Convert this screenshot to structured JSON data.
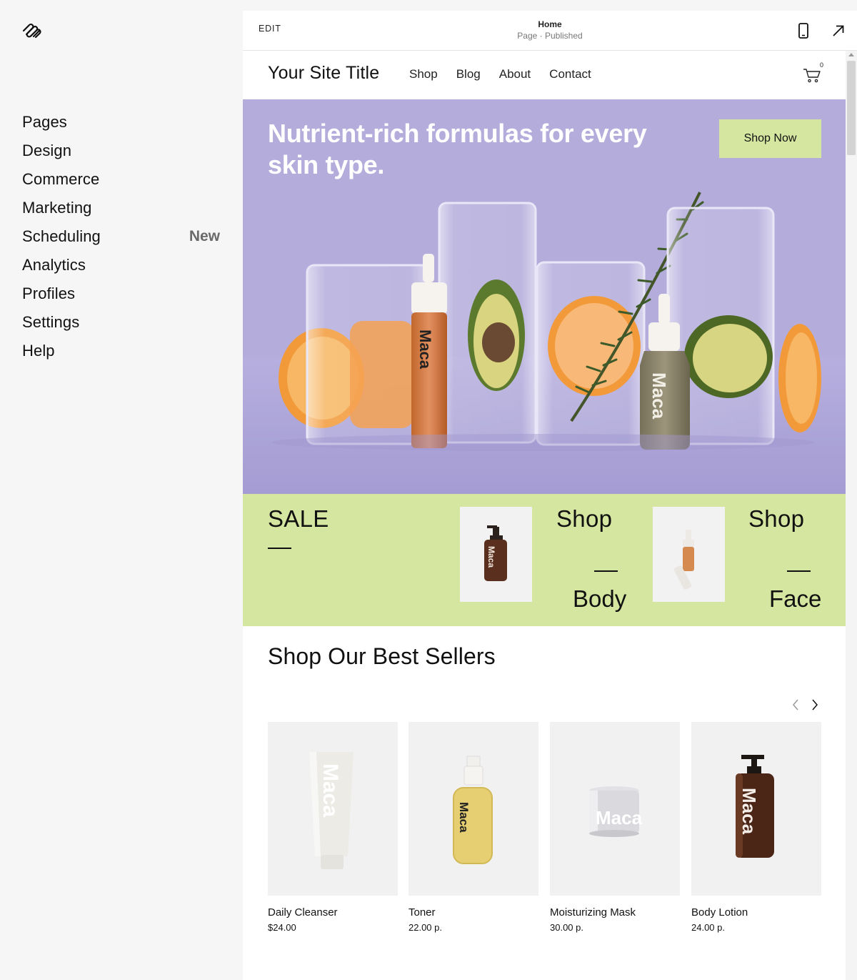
{
  "sidebar": {
    "items": [
      {
        "label": "Pages",
        "badge": ""
      },
      {
        "label": "Design",
        "badge": ""
      },
      {
        "label": "Commerce",
        "badge": ""
      },
      {
        "label": "Marketing",
        "badge": ""
      },
      {
        "label": "Scheduling",
        "badge": "New"
      },
      {
        "label": "Analytics",
        "badge": ""
      },
      {
        "label": "Profiles",
        "badge": ""
      },
      {
        "label": "Settings",
        "badge": ""
      },
      {
        "label": "Help",
        "badge": ""
      }
    ]
  },
  "toolbar": {
    "edit_label": "EDIT",
    "page_name": "Home",
    "page_status": "Page · Published",
    "mobile_icon": "mobile-phone-icon",
    "external_icon": "arrow-up-right-icon"
  },
  "site": {
    "title": "Your Site Title",
    "nav": [
      "Shop",
      "Blog",
      "About",
      "Contact"
    ],
    "cart_count": "0",
    "hero": {
      "headline": "Nutrient-rich formulas for every skin type.",
      "cta": "Shop Now",
      "bottle_brand": "Maca"
    },
    "promo": {
      "sale": "SALE",
      "shop_label": "Shop",
      "categories": [
        "Body",
        "Face"
      ]
    },
    "best_sellers": {
      "title": "Shop Our Best Sellers",
      "products": [
        {
          "name": "Daily Cleanser",
          "price": "$24.00"
        },
        {
          "name": "Toner",
          "price": "22.00 р."
        },
        {
          "name": "Moisturizing Mask",
          "price": "30.00 р."
        },
        {
          "name": "Body Lotion",
          "price": "24.00 р."
        }
      ]
    }
  },
  "colors": {
    "hero_bg": "#b4addc",
    "accent_green": "#d5e6a0",
    "sidebar_bg": "#f6f6f6"
  }
}
